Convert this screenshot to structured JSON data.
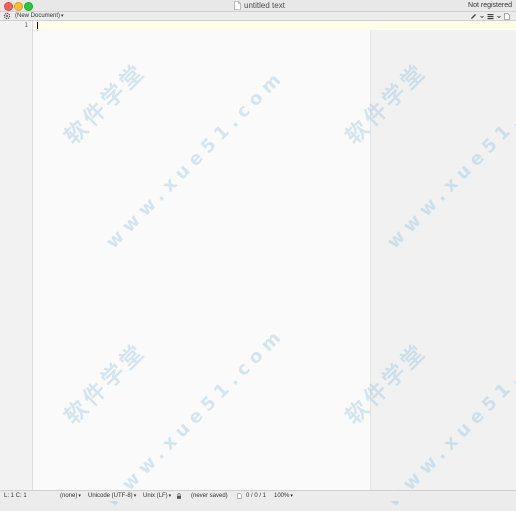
{
  "window": {
    "title": "untitled text",
    "registration": "Not registered"
  },
  "toolbar": {
    "document_selector": "(New Document)"
  },
  "editor": {
    "line_numbers": [
      "1"
    ]
  },
  "watermarks": {
    "brand": "软件学堂",
    "url": "www.xue51.com"
  },
  "status_bar": {
    "cursor_position": "L: 1 C: 1",
    "language": "(none)",
    "encoding": "Unicode (UTF-8)",
    "line_endings": "Unix (LF)",
    "save_state": "(never saved)",
    "doc_stats": "0 / 0 / 1",
    "zoom": "100%"
  },
  "colors": {
    "close": "#ff5f57",
    "minimize": "#febc2e",
    "maximize": "#28c840",
    "current_line": "#fffde7"
  }
}
